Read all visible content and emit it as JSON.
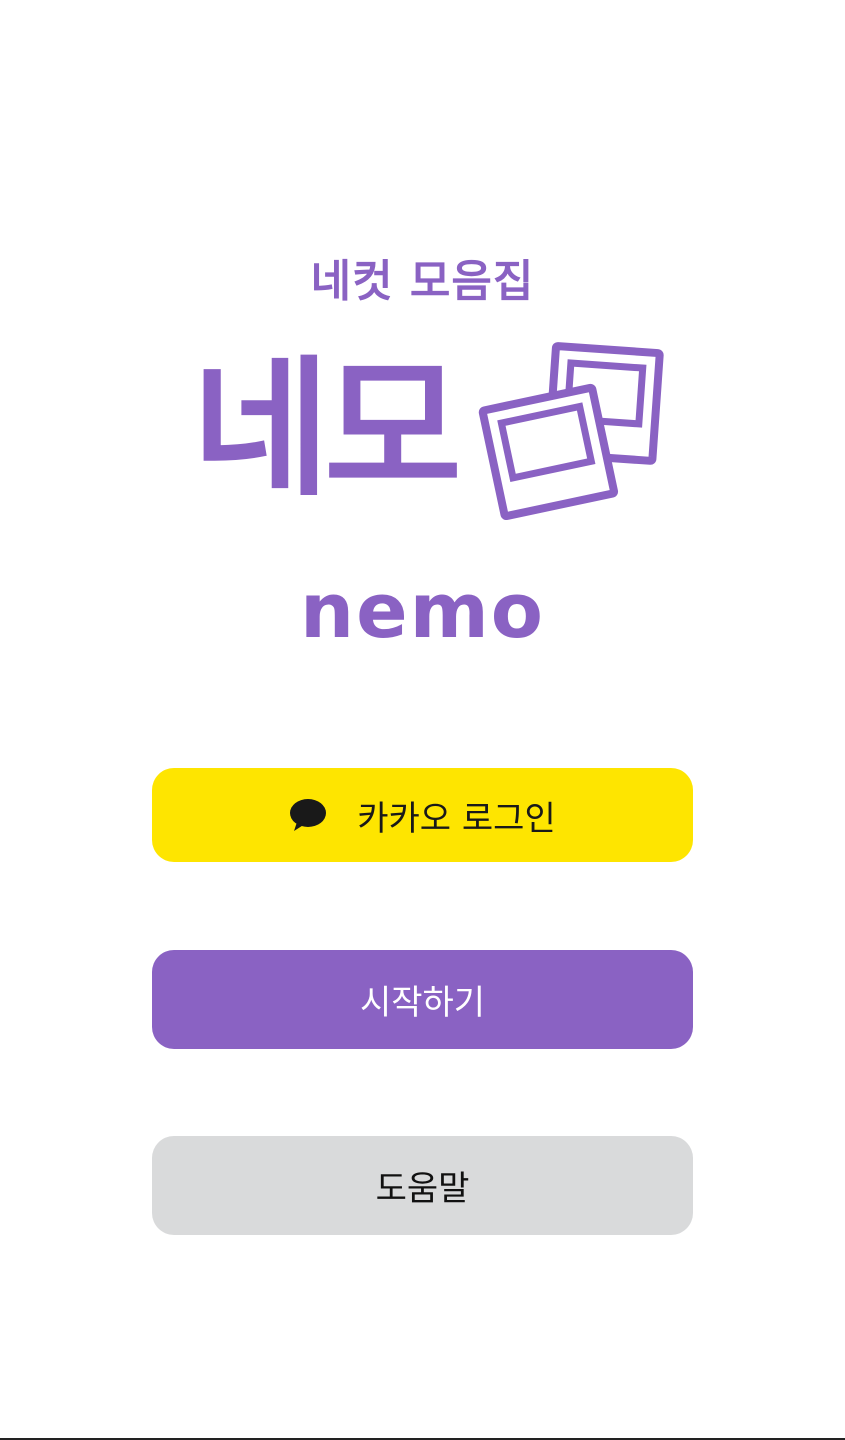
{
  "brand": {
    "tagline": "네컷 모음집",
    "title": "네모",
    "subtitle": "nemo",
    "icon": "polaroid-photos-icon",
    "accent_color": "#8a62c3"
  },
  "buttons": {
    "kakao": {
      "label": "카카오 로그인",
      "icon": "speech-bubble-icon",
      "color": "#fee500"
    },
    "start": {
      "label": "시작하기",
      "color": "#8a62c3"
    },
    "help": {
      "label": "도움말",
      "color": "#d9dadb"
    }
  }
}
